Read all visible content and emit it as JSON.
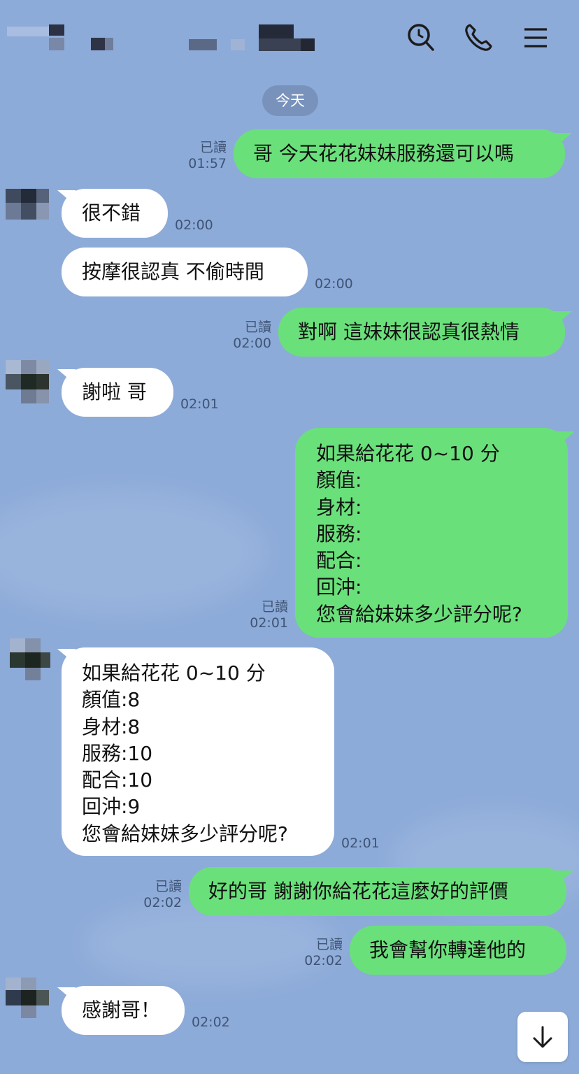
{
  "header": {
    "icons": [
      "search-icon",
      "phone-icon",
      "menu-icon"
    ]
  },
  "date_label": "今天",
  "read_label": "已讀",
  "messages": [
    {
      "side": "out",
      "text": "哥 今天花花妹妹服務還可以嗎",
      "time": "01:57",
      "read": true
    },
    {
      "side": "in",
      "text": "很不錯",
      "time": "02:00"
    },
    {
      "side": "in",
      "text": "按摩很認真 不偷時間",
      "time": "02:00"
    },
    {
      "side": "out",
      "text": "對啊 這妹妹很認真很熱情",
      "time": "02:00",
      "read": true
    },
    {
      "side": "in",
      "text": "謝啦 哥",
      "time": "02:01"
    },
    {
      "side": "out",
      "lines": [
        "如果給花花 0~10 分",
        "顏值:",
        "身材:",
        "服務:",
        "配合:",
        "回沖:",
        "您會給妹妹多少評分呢?"
      ],
      "time": "02:01",
      "read": true
    },
    {
      "side": "in",
      "lines": [
        "如果給花花 0~10 分",
        "顏值:8",
        "身材:8",
        "服務:10",
        "配合:10",
        "回沖:9",
        "您會給妹妹多少評分呢?"
      ],
      "time": "02:01"
    },
    {
      "side": "out",
      "text": "好的哥 謝謝你給花花這麼好的評價",
      "time": "02:02",
      "read": true
    },
    {
      "side": "out",
      "text": "我會幫你轉達他的",
      "time": "02:02",
      "read": true
    },
    {
      "side": "in",
      "text": "感謝哥！",
      "time": "02:02"
    }
  ],
  "colors": {
    "background": "#8dabd9",
    "outgoing_bubble": "#6ae07b",
    "incoming_bubble": "#ffffff",
    "date_pill": "#7992bc"
  }
}
